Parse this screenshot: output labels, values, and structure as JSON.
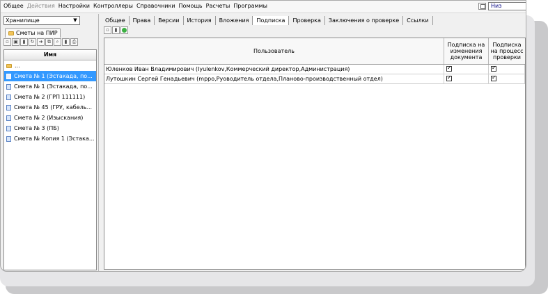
{
  "menubar": {
    "items": [
      "Общее",
      "Действия",
      "Настройки",
      "Контроллеры",
      "Справочники",
      "Помощь",
      "Расчеты",
      "Программы"
    ],
    "disabled": [
      "Действия"
    ],
    "position_select": "Низ"
  },
  "left": {
    "storage_select": "Хранилище",
    "tab_label": "Сметы на ПИР",
    "tree_header": "Имя",
    "tree_items": [
      {
        "label": "...",
        "icon": "folder-icon",
        "selected": false
      },
      {
        "label": "Смета № 1 (Эстакада, по...",
        "icon": "document-icon",
        "selected": true
      },
      {
        "label": "Смета № 1 (Эстакада, по...",
        "icon": "document-icon",
        "selected": false
      },
      {
        "label": "Смета № 2 (ГРП 111111)",
        "icon": "document-icon",
        "selected": false
      },
      {
        "label": "Смета № 45 (ГРУ, кабель...",
        "icon": "document-icon",
        "selected": false
      },
      {
        "label": "Смета № 2 (Изыскания)",
        "icon": "document-icon",
        "selected": false
      },
      {
        "label": "Смета № 3 (ПБ)",
        "icon": "document-icon",
        "selected": false
      },
      {
        "label": "Смета № Копия 1 (Эстака...",
        "icon": "document-icon",
        "selected": false
      }
    ]
  },
  "right": {
    "tabs": [
      "Общее",
      "Права",
      "Версии",
      "История",
      "Вложения",
      "Подписка",
      "Проверка",
      "Заключения о проверке",
      "Ссылки"
    ],
    "active_tab": "Подписка",
    "columns": {
      "user": "Пользователь",
      "doc_changes": "Подписка на изменения документа",
      "check_process": "Подписка на процесс проверки"
    },
    "rows": [
      {
        "user": "Юленков Иван Владимирович (Iyulenkov,Коммерческий директор,Администрация)",
        "doc_changes": true,
        "check_process": true
      },
      {
        "user": "Лутошкин Сергей Генадьевич (mppo,Руоводитель отдела,Планово-производственный отдел)",
        "doc_changes": true,
        "check_process": true
      }
    ]
  },
  "colors": {
    "selection": "#3399ff",
    "folder": "#f2c45a",
    "ok": "#3cb043"
  }
}
